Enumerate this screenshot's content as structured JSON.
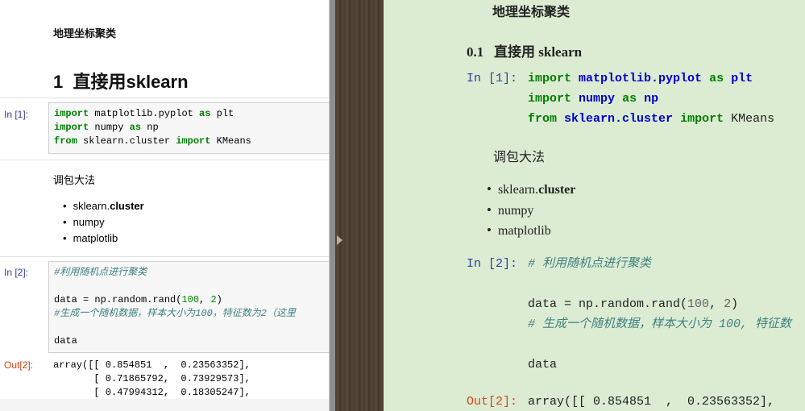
{
  "left": {
    "title": "地理坐标聚类",
    "heading_number": "1",
    "heading_text": "直接用sklearn",
    "cells": [
      {
        "prompt": "In [1]:",
        "lines": [
          {
            "kw": "import",
            "rest": " matplotlib.pyplot ",
            "kw2": "as",
            "rest2": " plt"
          },
          {
            "kw": "import",
            "rest": " numpy ",
            "kw2": "as",
            "rest2": " np"
          },
          {
            "kw": "from",
            "rest": " sklearn.cluster ",
            "kw2": "import",
            "rest2": " KMeans"
          }
        ]
      },
      {
        "prompt": "In [2]:",
        "comment1": "#利用随机点进行聚类",
        "code_data": "data = np.random.rand(",
        "num1": "100",
        "comma": ", ",
        "num2": "2",
        "close": ")",
        "comment2": "#生成一个随机数据，样本大小为100，特征数为2（这里",
        "data_line": "data"
      }
    ],
    "markdown_text": "调包大法",
    "list_items": [
      {
        "plain": "sklearn.",
        "bold": "cluster"
      },
      {
        "plain": "numpy",
        "bold": ""
      },
      {
        "plain": "matplotlib",
        "bold": ""
      }
    ],
    "output_prompt": "Out[2]:",
    "output_lines": [
      "array([[ 0.854851  ,  0.23563352],",
      "       [ 0.71865792,  0.73929573],",
      "       [ 0.47994312,  0.18305247],"
    ]
  },
  "right": {
    "title": "地理坐标聚类",
    "heading_number": "0.1",
    "heading_text": "直接用 sklearn",
    "cell1_prompt": "In [1]:",
    "cell1_lines": [
      {
        "kw": "import",
        "mod": "matplotlib.pyplot",
        "kw2": "as",
        "name": "plt"
      },
      {
        "kw": "import",
        "mod": "numpy",
        "kw2": "as",
        "name": "np"
      },
      {
        "kw": "from",
        "mod": "sklearn.cluster",
        "kw2": "import",
        "name": "KMeans"
      }
    ],
    "markdown_text": "调包大法",
    "list_items": [
      {
        "plain": "sklearn.",
        "bold": "cluster"
      },
      {
        "plain": "numpy",
        "bold": ""
      },
      {
        "plain": "matplotlib",
        "bold": ""
      }
    ],
    "cell2_prompt": "In [2]:",
    "cell2_comment1": "# 利用随机点进行聚类",
    "cell2_code": "data = np.random.rand(",
    "cell2_num1": "100",
    "cell2_comma": ", ",
    "cell2_num2": "2",
    "cell2_close": ")",
    "cell2_comment2": "# 生成一个随机数据，样本大小为 100, 特征数",
    "cell2_data": "data",
    "output_prompt": "Out[2]:",
    "output_line": "array([[ 0.854851  ,  0.23563352],"
  },
  "colors": {
    "keyword": "#008000",
    "module": "#0000cc",
    "in_prompt": "#303f9f",
    "out_prompt": "#d84315",
    "preview_bg": "#dcecd2"
  }
}
